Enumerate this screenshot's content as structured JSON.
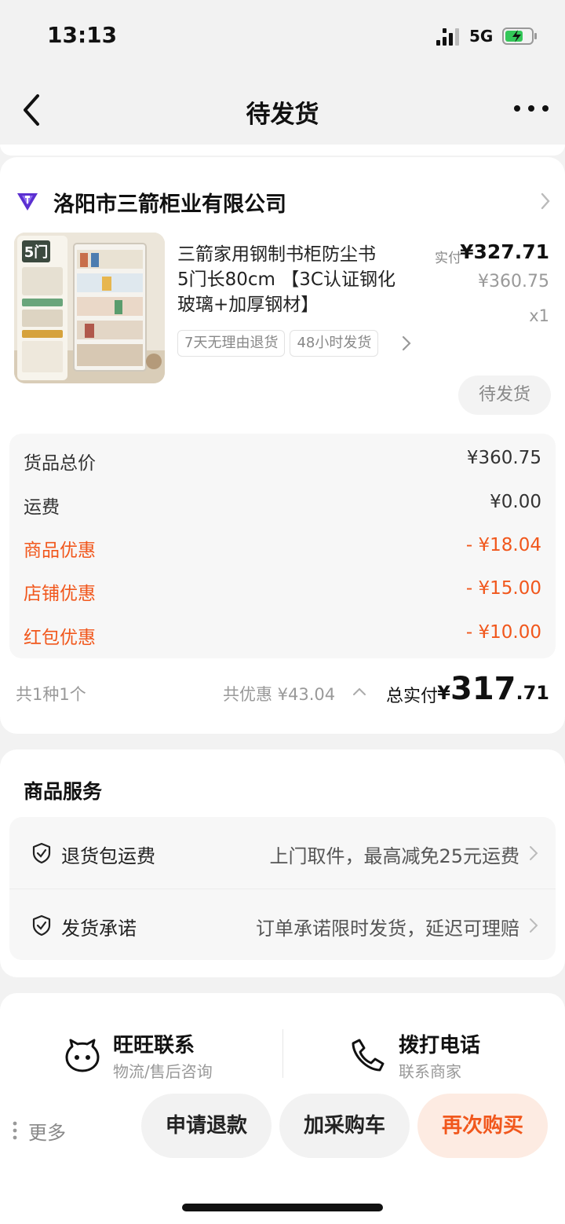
{
  "status_bar": {
    "time": "13:13",
    "network": "5G"
  },
  "nav": {
    "title": "待发货"
  },
  "shop": {
    "name": "洛阳市三箭柜业有限公司"
  },
  "product": {
    "title_lines": [
      "三箭家用钢制书柜防尘书",
      "5门长80cm 【3C认证钢化",
      "玻璃+加厚钢材】"
    ],
    "paid_label": "实付",
    "paid_price": "¥327.71",
    "original_price": "¥360.75",
    "quantity": "x1",
    "tags": [
      "7天无理由退货",
      "48小时发货"
    ],
    "status": "待发货",
    "image_badge": "5门"
  },
  "price_detail": [
    {
      "label": "货品总价",
      "value": "¥360.75",
      "type": "normal"
    },
    {
      "label": "运费",
      "value": "¥0.00",
      "type": "normal"
    },
    {
      "label": "商品优惠",
      "value": "- ¥18.04",
      "type": "discount"
    },
    {
      "label": "店铺优惠",
      "value": "- ¥15.00",
      "type": "discount"
    },
    {
      "label": "红包优惠",
      "value": "- ¥10.00",
      "type": "discount"
    }
  ],
  "summary": {
    "count": "共1种1个",
    "discount_total": "共优惠 ¥43.04",
    "total_label": "总实付",
    "total_currency": "¥",
    "total_int": "317",
    "total_dec": ".71"
  },
  "services": {
    "title": "商品服务",
    "items": [
      {
        "name": "退货包运费",
        "desc": "上门取件，最高减免25元运费"
      },
      {
        "name": "发货承诺",
        "desc": "订单承诺限时发货，延迟可理赔"
      }
    ]
  },
  "contacts": {
    "wangwang": {
      "title": "旺旺联系",
      "subtitle": "物流/售后咨询"
    },
    "phone": {
      "title": "拨打电话",
      "subtitle": "联系商家"
    }
  },
  "actions": {
    "more": "更多",
    "refund": "申请退款",
    "add_cart": "加采购车",
    "rebuy": "再次购买"
  },
  "colors": {
    "accent": "#f1571c",
    "accent_bg": "#fdebe2",
    "page_bg": "#f2f2f2"
  },
  "icons": {
    "back": "chevron-left-icon",
    "more": "more-dots-icon",
    "shop": "shop-diamond-icon",
    "service": "shield-check-icon",
    "wangwang": "wangwang-icon",
    "phone": "phone-icon"
  }
}
